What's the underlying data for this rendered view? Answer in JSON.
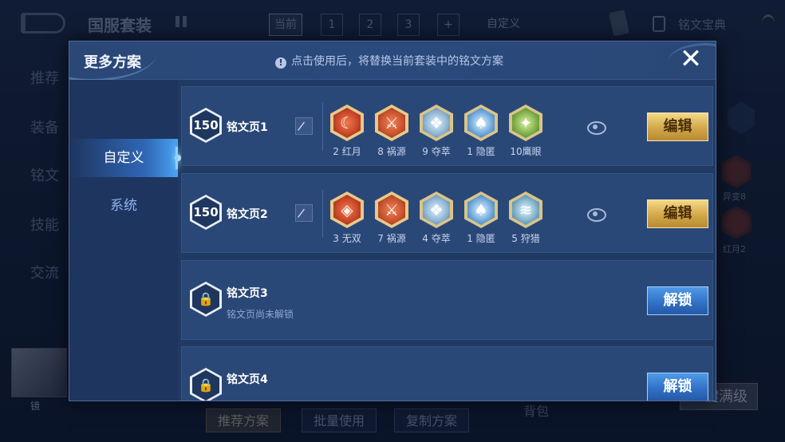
{
  "background": {
    "title": "国服套装",
    "tabs": [
      "当前",
      "1",
      "2",
      "3",
      "+",
      "自定义"
    ],
    "right_label": "铭文宝典",
    "left_menu": [
      "推荐",
      "装备",
      "铭文",
      "技能",
      "交流"
    ],
    "hero_label": "镜",
    "bottom_buttons": [
      "推荐方案",
      "批量使用",
      "复制方案"
    ],
    "bottom_text": "背包",
    "max_level_button": "一键满级",
    "side_runes": [
      "异变8",
      "红月2"
    ]
  },
  "modal": {
    "title": "更多方案",
    "notice": "点击使用后，将替换当前套装中的铭文方案",
    "info_glyph": "!",
    "close_glyph": "✕",
    "sidebar": [
      {
        "label": "自定义",
        "active": true
      },
      {
        "label": "系统",
        "active": false
      }
    ],
    "pages": [
      {
        "level": "150",
        "name": "铭文页1",
        "runes": [
          {
            "label": "2 红月",
            "color": "#c8462a",
            "icon": "crescent-icon"
          },
          {
            "label": "8 祸源",
            "color": "#c9532f",
            "icon": "feather-icon"
          },
          {
            "label": "9 夺萃",
            "color": "#7fa7c8",
            "icon": "knot-icon"
          },
          {
            "label": "1 隐匿",
            "color": "#6ea8dc",
            "icon": "flame-icon"
          },
          {
            "label": "10鹰眼",
            "color": "#7fb04a",
            "icon": "star-icon"
          }
        ],
        "button": "编辑"
      },
      {
        "level": "150",
        "name": "铭文页2",
        "runes": [
          {
            "label": "3 无双",
            "color": "#c8462a",
            "icon": "eye-icon"
          },
          {
            "label": "7 祸源",
            "color": "#c9532f",
            "icon": "feather-icon"
          },
          {
            "label": "4 夺萃",
            "color": "#7fa7c8",
            "icon": "knot-icon"
          },
          {
            "label": "1 隐匿",
            "color": "#6ea8dc",
            "icon": "flame-icon"
          },
          {
            "label": "5 狩猎",
            "color": "#7fb0c8",
            "icon": "wind-icon"
          }
        ],
        "button": "编辑"
      },
      {
        "name": "铭文页3",
        "sub": "铭文页尚未解锁",
        "button": "解锁"
      },
      {
        "name": "铭文页4",
        "button": "解锁"
      }
    ]
  }
}
